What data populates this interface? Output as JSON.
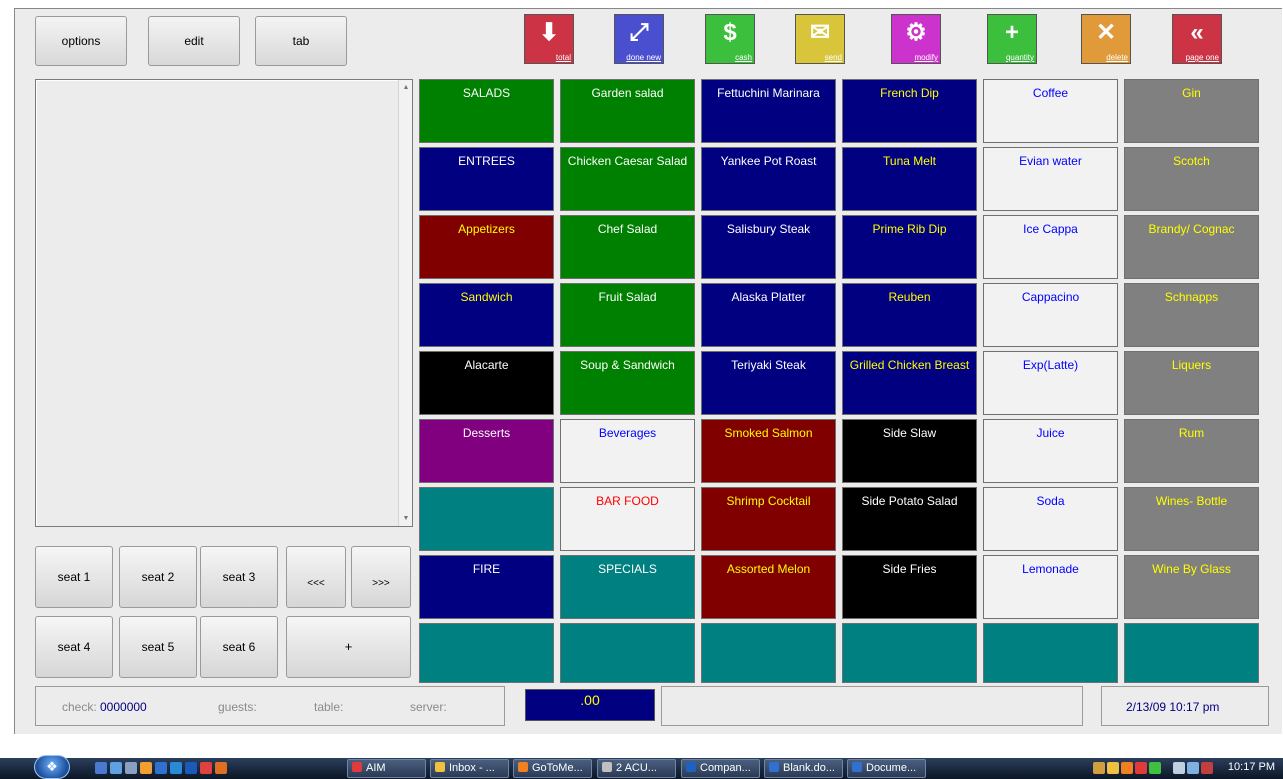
{
  "toolbar": {
    "options": "options",
    "edit": "edit",
    "tab": "tab"
  },
  "tools": [
    {
      "label": "total",
      "icon": "total-icon",
      "color": "#cc3344"
    },
    {
      "label": "done new",
      "icon": "done-new-icon",
      "color": "#4a4fd0"
    },
    {
      "label": "cash",
      "icon": "cash-icon",
      "color": "#3cbf3c"
    },
    {
      "label": "send",
      "icon": "send-icon",
      "color": "#d9c53a"
    },
    {
      "label": "modify",
      "icon": "modify-icon",
      "color": "#cc33cc"
    },
    {
      "label": "quantity",
      "icon": "quantity-icon",
      "color": "#3cbf3c"
    },
    {
      "label": "delete",
      "icon": "delete-icon",
      "color": "#e09a3a"
    },
    {
      "label": "page one",
      "icon": "page-one-icon",
      "color": "#cc3344"
    }
  ],
  "seats": [
    "seat 1",
    "seat 2",
    "seat 3",
    "seat 4",
    "seat 5",
    "seat 6"
  ],
  "nav": {
    "prev": "<<<",
    "next": ">>>",
    "plus": "+"
  },
  "menu": {
    "columns": [
      [
        {
          "label": "SALADS",
          "style": "green"
        },
        {
          "label": "ENTREES",
          "style": "navy"
        },
        {
          "label": "Appetizers",
          "style": "red"
        },
        {
          "label": "Sandwich",
          "style": "navy-y"
        },
        {
          "label": "Alacarte",
          "style": "black"
        },
        {
          "label": "Desserts",
          "style": "purple"
        },
        {
          "label": "",
          "style": "teal"
        },
        {
          "label": "FIRE",
          "style": "navy"
        },
        {
          "label": "",
          "style": "teal"
        }
      ],
      [
        {
          "label": "Garden salad",
          "style": "green"
        },
        {
          "label": "Chicken Caesar Salad",
          "style": "green"
        },
        {
          "label": "Chef Salad",
          "style": "green"
        },
        {
          "label": "Fruit Salad",
          "style": "green"
        },
        {
          "label": "Soup & Sandwich",
          "style": "green"
        },
        {
          "label": "Beverages",
          "style": "white"
        },
        {
          "label": "BAR FOOD",
          "style": "white-r"
        },
        {
          "label": "SPECIALS",
          "style": "teal"
        },
        {
          "label": "",
          "style": "teal"
        }
      ],
      [
        {
          "label": "Fettuchini Marinara",
          "style": "navy"
        },
        {
          "label": "Yankee Pot Roast",
          "style": "navy"
        },
        {
          "label": "Salisbury Steak",
          "style": "navy"
        },
        {
          "label": "Alaska Platter",
          "style": "navy"
        },
        {
          "label": "Teriyaki Steak",
          "style": "navy"
        },
        {
          "label": "Smoked Salmon",
          "style": "red"
        },
        {
          "label": "Shrimp Cocktail",
          "style": "red"
        },
        {
          "label": "Assorted Melon",
          "style": "red"
        },
        {
          "label": "",
          "style": "teal"
        }
      ],
      [
        {
          "label": "French Dip",
          "style": "navy-y"
        },
        {
          "label": "Tuna Melt",
          "style": "navy-y"
        },
        {
          "label": "Prime Rib Dip",
          "style": "navy-y"
        },
        {
          "label": "Reuben",
          "style": "navy-y"
        },
        {
          "label": "Grilled Chicken Breast",
          "style": "navy-y"
        },
        {
          "label": "Side Slaw",
          "style": "black"
        },
        {
          "label": "Side Potato Salad",
          "style": "black"
        },
        {
          "label": "Side Fries",
          "style": "black"
        },
        {
          "label": "",
          "style": "teal"
        }
      ],
      [
        {
          "label": "Coffee",
          "style": "white"
        },
        {
          "label": "Evian water",
          "style": "white"
        },
        {
          "label": "Ice Cappa",
          "style": "white"
        },
        {
          "label": "Cappacino",
          "style": "white"
        },
        {
          "label": "Exp(Latte)",
          "style": "white"
        },
        {
          "label": "Juice",
          "style": "white"
        },
        {
          "label": "Soda",
          "style": "white"
        },
        {
          "label": "Lemonade",
          "style": "white"
        },
        {
          "label": "",
          "style": "teal"
        }
      ],
      [
        {
          "label": "Gin",
          "style": "gray"
        },
        {
          "label": "Scotch",
          "style": "gray"
        },
        {
          "label": "Brandy/ Cognac",
          "style": "gray"
        },
        {
          "label": "Schnapps",
          "style": "gray"
        },
        {
          "label": "Liquers",
          "style": "gray"
        },
        {
          "label": "Rum",
          "style": "gray"
        },
        {
          "label": "Wines- Bottle",
          "style": "gray"
        },
        {
          "label": "Wine By Glass",
          "style": "gray"
        },
        {
          "label": "",
          "style": "teal"
        }
      ]
    ]
  },
  "status": {
    "check_label": "check:",
    "check_value": "0000000",
    "guests_label": "guests:",
    "table_label": "table:",
    "server_label": "server:",
    "total": ".00",
    "datetime": "2/13/09  10:17 pm"
  },
  "taskbar": {
    "items": [
      {
        "label": "AIM",
        "icon_color": "#e03a3a"
      },
      {
        "label": "Inbox - ...",
        "icon_color": "#f0c040"
      },
      {
        "label": "GoToMe...",
        "icon_color": "#f08020"
      },
      {
        "label": "2 ACU...",
        "icon_color": "#c0c0c0"
      },
      {
        "label": "Compan...",
        "icon_color": "#2060c0"
      },
      {
        "label": "Blank.do...",
        "icon_color": "#3070d0"
      },
      {
        "label": "Docume...",
        "icon_color": "#3070d0"
      }
    ],
    "clock": "10:17 PM"
  }
}
